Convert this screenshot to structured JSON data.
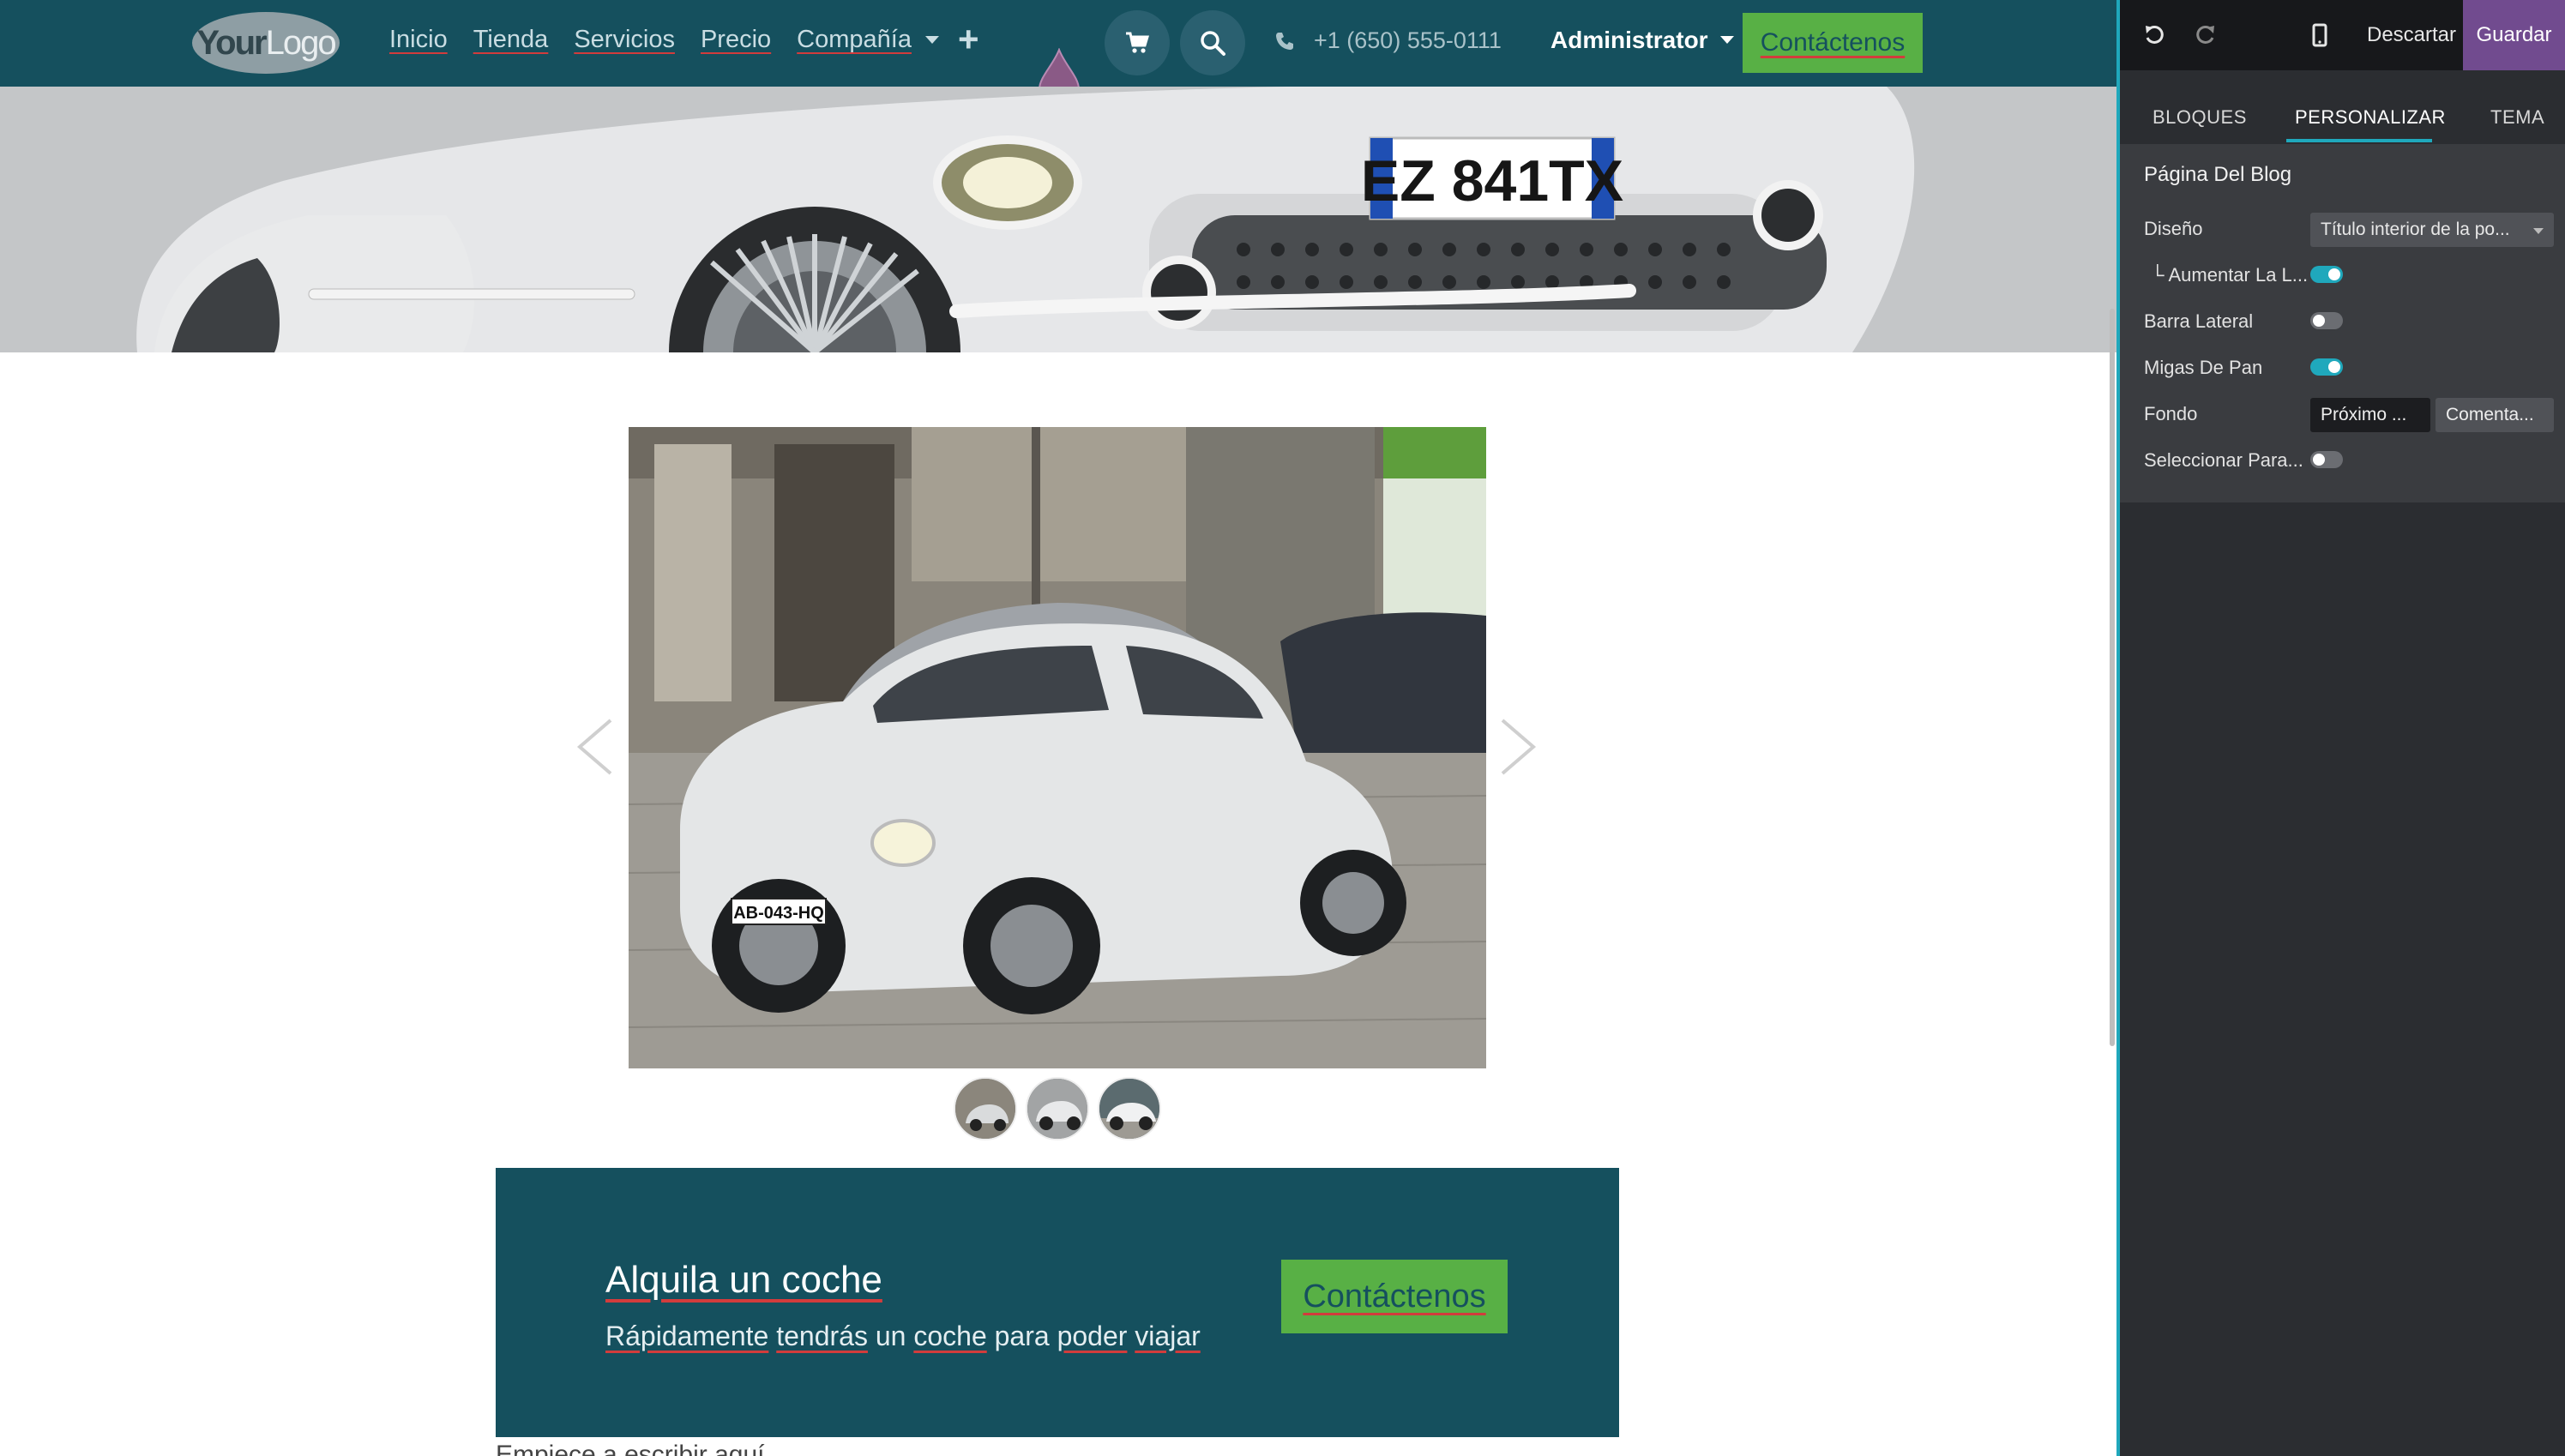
{
  "navbar": {
    "logo_your": "Your",
    "logo_logo": "Logo",
    "menu": [
      {
        "label": "Inicio"
      },
      {
        "label": "Tienda"
      },
      {
        "label": "Servicios"
      },
      {
        "label": "Precio"
      },
      {
        "label": "Compañía",
        "has_dropdown": true
      }
    ],
    "add_icon": "plus-icon",
    "cart_icon": "cart-icon",
    "search_icon": "search-icon",
    "phone_icon": "phone-icon",
    "phone": "+1 (650) 555-0111",
    "user": "Administrator",
    "cta": "Contáctenos"
  },
  "banner": {
    "plate": "EZ 841TX"
  },
  "carousel": {
    "plate": "AB-043-HQ",
    "prev_icon": "chevron-left-icon",
    "next_icon": "chevron-right-icon",
    "thumbnails": 3
  },
  "cta_block": {
    "title": "Alquila un coche",
    "subtitle_words": [
      "Rápidamente",
      "tendrás",
      "un",
      "coche",
      "para",
      "poder",
      "viajar"
    ],
    "button": "Contáctenos"
  },
  "start_text": "Empiece a escribir aquí",
  "editor": {
    "undo_icon": "undo-icon",
    "redo_icon": "redo-icon",
    "mobile_icon": "mobile-icon",
    "discard": "Descartar",
    "save": "Guardar",
    "tabs": [
      "BLOQUES",
      "PERSONALIZAR",
      "TEMA"
    ],
    "active_tab": "PERSONALIZAR",
    "section_title": "Página Del Blog",
    "rows": {
      "design_label": "Diseño",
      "design_value": "Título interior de la po...",
      "increase_label": "└ Aumentar La L...",
      "increase_on": true,
      "sidebar_label": "Barra Lateral",
      "sidebar_on": false,
      "breadcrumbs_label": "Migas De Pan",
      "breadcrumbs_on": true,
      "background_label": "Fondo",
      "background_next": "Próximo ...",
      "background_comments": "Comenta...",
      "select_label": "Seleccionar Para...",
      "select_on": false
    }
  },
  "colors": {
    "primary": "#15505e",
    "cta_green": "#58b045",
    "editor_accent": "#1fa8bc",
    "save_purple": "#714b8f"
  }
}
